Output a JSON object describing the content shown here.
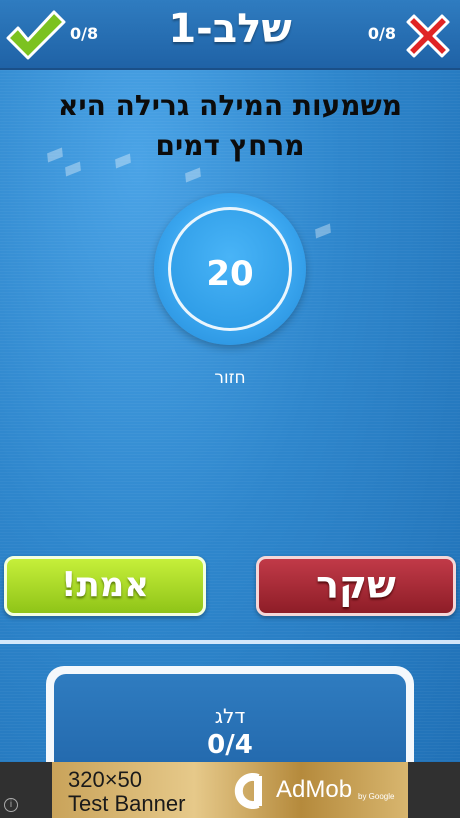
{
  "header": {
    "level_title": "שלב-1",
    "correct_score": "0/8",
    "wrong_score": "0/8",
    "check_icon": "green-checkmark-icon",
    "x_icon": "red-x-icon"
  },
  "question": {
    "line1": "משמעות המילה גרילה היא",
    "line2": "מרחץ דמים"
  },
  "timer": {
    "value": "20"
  },
  "repeat_label": "חזור",
  "answers": {
    "true_label": "אמת!",
    "false_label": "שקר"
  },
  "skip": {
    "label": "דלג",
    "count": "0/4"
  },
  "ad": {
    "size_text": "320×50",
    "banner_text": "Test Banner",
    "brand": "AdMob",
    "by_text": "by Google",
    "info_icon": "info-icon"
  },
  "colors": {
    "background": "#2a7fc4",
    "true_button": "#9fd124",
    "false_button": "#a52a36",
    "timer": "#3aa6ef"
  }
}
